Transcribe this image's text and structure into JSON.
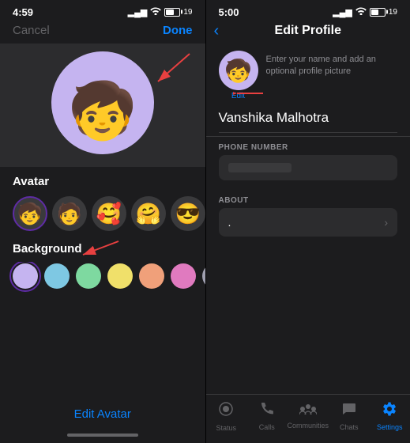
{
  "left": {
    "status_time": "4:59",
    "signal": "▂▄▆",
    "wifi": "wifi",
    "battery": "19",
    "cancel": "Cancel",
    "done": "Done",
    "avatar_section_label": "Avatar",
    "background_label": "Background",
    "edit_avatar_btn": "Edit Avatar",
    "avatars": [
      {
        "emoji": "👩",
        "selected": true
      },
      {
        "emoji": "🧑",
        "selected": false
      },
      {
        "emoji": "🥰",
        "selected": false
      },
      {
        "emoji": "🤗",
        "selected": false
      },
      {
        "emoji": "😎",
        "selected": false
      }
    ],
    "colors": [
      {
        "color": "#c5b4f0",
        "selected": true
      },
      {
        "color": "#7ec8e3",
        "selected": false
      },
      {
        "color": "#7ed9a0",
        "selected": false
      },
      {
        "color": "#f0e06a",
        "selected": false
      },
      {
        "color": "#f0a07a",
        "selected": false
      },
      {
        "color": "#e07abf",
        "selected": false
      },
      {
        "color": "#a0a0b0",
        "selected": false
      }
    ]
  },
  "right": {
    "status_time": "5:00",
    "signal": "▂▄▆",
    "wifi": "wifi",
    "battery": "19",
    "back": "‹",
    "title": "Edit Profile",
    "profile_hint": "Enter your name and add an optional profile picture",
    "edit_label": "Edit",
    "name": "Vanshika Malhotra",
    "phone_label": "PHONE NUMBER",
    "phone_value": "",
    "about_label": "ABOUT",
    "about_value": ".",
    "tabs": [
      {
        "icon": "⊙",
        "label": "Status",
        "active": false
      },
      {
        "icon": "✆",
        "label": "Calls",
        "active": false
      },
      {
        "icon": "⊞",
        "label": "Communities",
        "active": false
      },
      {
        "icon": "💬",
        "label": "Chats",
        "active": false
      },
      {
        "icon": "⚙",
        "label": "Settings",
        "active": true
      }
    ]
  }
}
